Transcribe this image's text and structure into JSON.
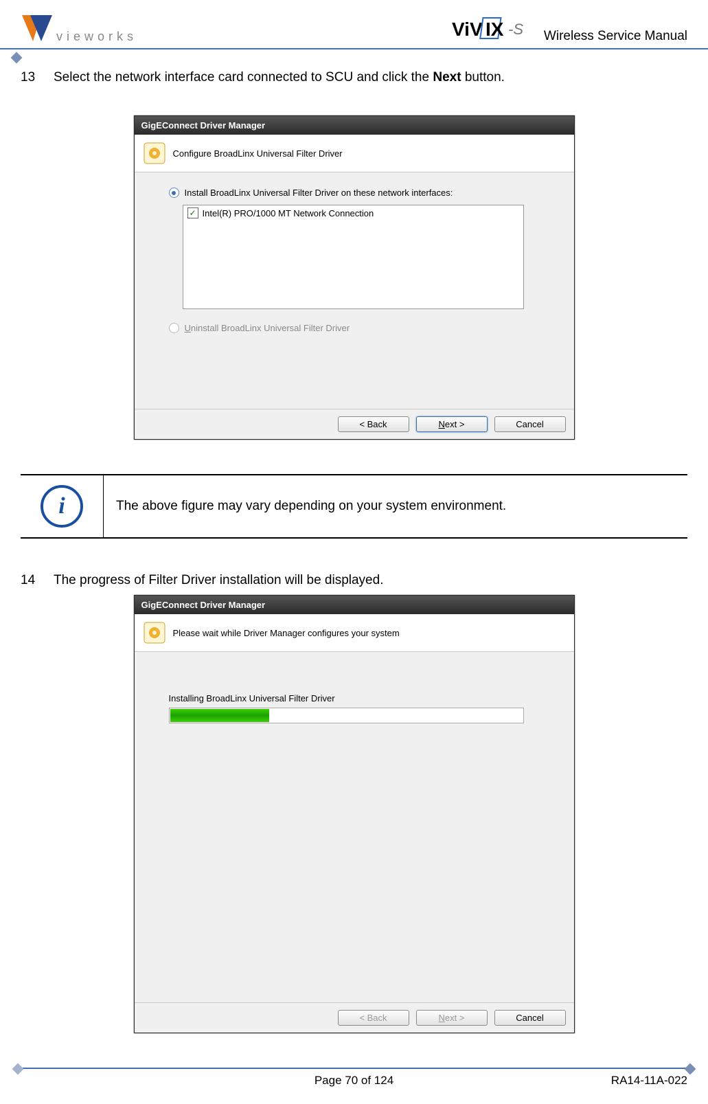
{
  "header": {
    "brand": "vieworks",
    "productLogoTop": "ViVIX",
    "productLogoSuffix": "-S",
    "manualTitle": "Wireless Service Manual"
  },
  "step13": {
    "num": "13",
    "text_before": "Select the network interface card connected to SCU and click the ",
    "bold": "Next",
    "text_after": " button."
  },
  "dialog1": {
    "title": "GigEConnect Driver Manager",
    "headText": "Configure BroadLinx Universal Filter Driver",
    "radioInstall": "Install BroadLinx Universal Filter Driver on these network interfaces:",
    "listItem": "Intel(R) PRO/1000 MT Network Connection",
    "radioUninstall": "Uninstall BroadLinx Universal Filter Driver",
    "btnBack": "< Back",
    "btnNext": "Next >",
    "btnCancel": "Cancel"
  },
  "note": {
    "text": "The above figure may vary depending on your system environment."
  },
  "step14": {
    "num": "14",
    "text": "The progress of Filter Driver installation will be displayed."
  },
  "dialog2": {
    "title": "GigEConnect Driver Manager",
    "headText": "Please wait while Driver Manager configures your system",
    "progressLabel": "Installing BroadLinx Universal Filter Driver",
    "btnBack": "< Back",
    "btnNext": "Next >",
    "btnCancel": "Cancel"
  },
  "footer": {
    "page": "Page 70 of 124",
    "doc": "RA14-11A-022"
  }
}
